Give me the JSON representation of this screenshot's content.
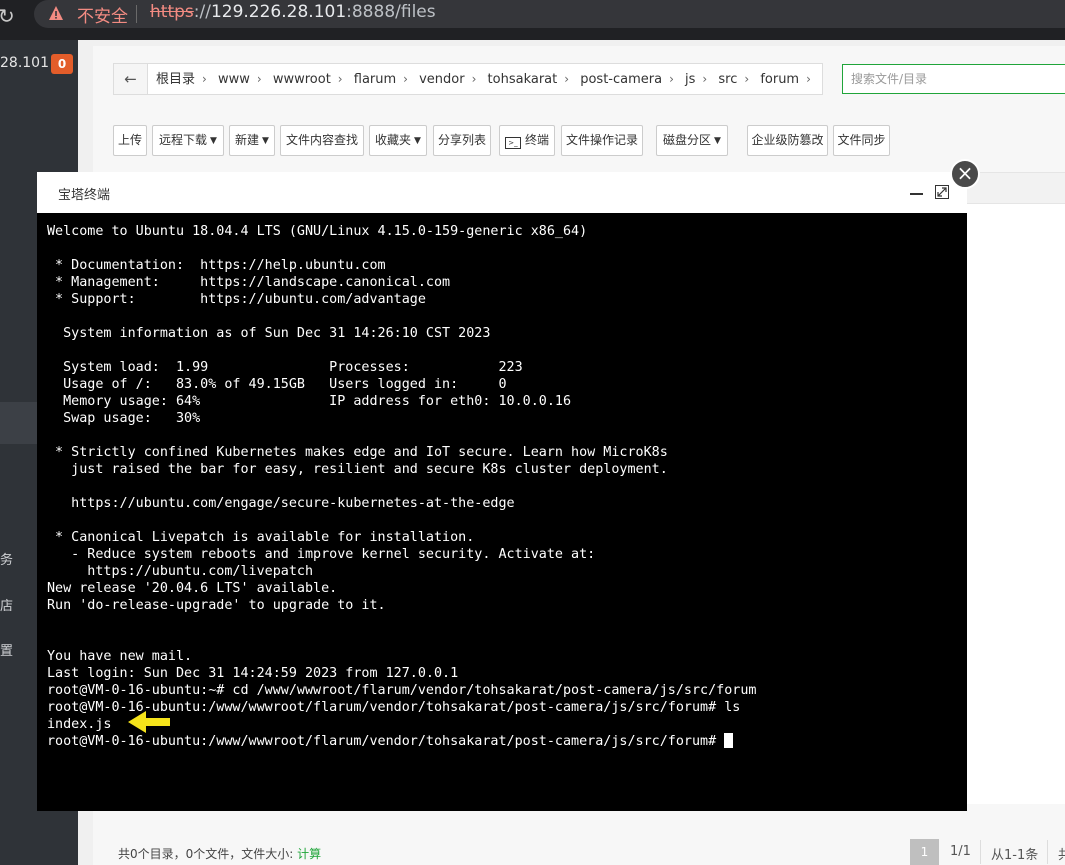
{
  "browser": {
    "insecure_label": "不安全",
    "url_scheme": "https",
    "url_sep": "://",
    "url_host": "129.226.28.101",
    "url_path": ":8888/files"
  },
  "sidebar": {
    "ip_fragment": "28.101",
    "badge": "0",
    "items": [
      "务",
      "店",
      "置"
    ]
  },
  "breadcrumb": {
    "segments": [
      "根目录",
      "www",
      "wwwroot",
      "flarum",
      "vendor",
      "tohsakarat",
      "post-camera",
      "js",
      "src",
      "forum"
    ]
  },
  "search": {
    "placeholder": "搜索文件/目录"
  },
  "toolbar": {
    "upload": "上传",
    "remote_download": "远程下载",
    "new": "新建",
    "content_search": "文件内容查找",
    "favorites": "收藏夹",
    "share_list": "分享列表",
    "terminal": "终端",
    "terminal_glyph": ">_",
    "file_log": "文件操作记录",
    "disk_partition": "磁盘分区",
    "tamper_proof": "企业级防篡改",
    "file_sync": "文件同步"
  },
  "footer": {
    "summary": "共0个目录，0个文件，文件大小:",
    "calc_link": "计算",
    "page_current": "1",
    "page_total": "1/1",
    "range": "从1-1条",
    "more": "共"
  },
  "terminal": {
    "title": "宝塔终端",
    "close": "×",
    "lines": [
      "Welcome to Ubuntu 18.04.4 LTS (GNU/Linux 4.15.0-159-generic x86_64)",
      "",
      " * Documentation:  https://help.ubuntu.com",
      " * Management:     https://landscape.canonical.com",
      " * Support:        https://ubuntu.com/advantage",
      "",
      "  System information as of Sun Dec 31 14:26:10 CST 2023",
      "",
      "  System load:  1.99               Processes:           223",
      "  Usage of /:   83.0% of 49.15GB   Users logged in:     0",
      "  Memory usage: 64%                IP address for eth0: 10.0.0.16",
      "  Swap usage:   30%",
      "",
      " * Strictly confined Kubernetes makes edge and IoT secure. Learn how MicroK8s",
      "   just raised the bar for easy, resilient and secure K8s cluster deployment.",
      "",
      "   https://ubuntu.com/engage/secure-kubernetes-at-the-edge",
      "",
      " * Canonical Livepatch is available for installation.",
      "   - Reduce system reboots and improve kernel security. Activate at:",
      "     https://ubuntu.com/livepatch",
      "New release '20.04.6 LTS' available.",
      "Run 'do-release-upgrade' to upgrade to it.",
      "",
      "",
      "You have new mail.",
      "Last login: Sun Dec 31 14:24:59 2023 from 127.0.0.1",
      "root@VM-0-16-ubuntu:~# cd /www/wwwroot/flarum/vendor/tohsakarat/post-camera/js/src/forum",
      "root@VM-0-16-ubuntu:/www/wwwroot/flarum/vendor/tohsakarat/post-camera/js/src/forum# ls",
      "index.js",
      "root@VM-0-16-ubuntu:/www/wwwroot/flarum/vendor/tohsakarat/post-camera/js/src/forum# "
    ],
    "arrow_color": "#f5e31a"
  }
}
